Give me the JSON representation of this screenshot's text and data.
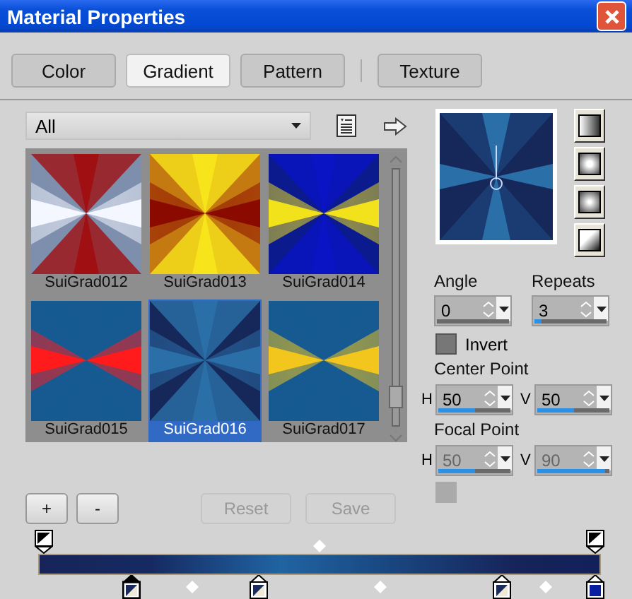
{
  "window": {
    "title": "Material Properties"
  },
  "tabs": [
    {
      "label": "Color",
      "selected": false
    },
    {
      "label": "Gradient",
      "selected": true
    },
    {
      "label": "Pattern",
      "selected": false
    },
    {
      "label": "Texture",
      "selected": false
    }
  ],
  "category": {
    "value": "All"
  },
  "gradients": [
    {
      "name": "SuiGrad012",
      "selected": false
    },
    {
      "name": "SuiGrad013",
      "selected": false
    },
    {
      "name": "SuiGrad014",
      "selected": false
    },
    {
      "name": "SuiGrad015",
      "selected": false
    },
    {
      "name": "SuiGrad016",
      "selected": true
    },
    {
      "name": "SuiGrad017",
      "selected": false
    }
  ],
  "angle": {
    "label": "Angle",
    "value": "0"
  },
  "repeats": {
    "label": "Repeats",
    "value": "3",
    "level": 0.1
  },
  "invert": {
    "label": "Invert",
    "checked": false
  },
  "center_point": {
    "label": "Center Point",
    "h": {
      "label": "H",
      "value": "50",
      "level": 0.5
    },
    "v": {
      "label": "V",
      "value": "50",
      "level": 0.5
    },
    "disabled": false
  },
  "focal_point": {
    "label": "Focal Point",
    "h": {
      "label": "H",
      "value": "50",
      "level": 0.5
    },
    "v": {
      "label": "V",
      "value": "90",
      "level": 0.95
    },
    "disabled": true
  },
  "focal_checkbox": {
    "checked": false,
    "disabled": true
  },
  "buttons": [
    {
      "label": "+",
      "disabled": false
    },
    {
      "label": "-",
      "disabled": false
    },
    {
      "label": "Reset",
      "disabled": true
    },
    {
      "label": "Save",
      "disabled": true
    }
  ],
  "opacity_stops": [
    {
      "level": 0,
      "selected": false
    },
    {
      "level": 1,
      "selected": false
    }
  ],
  "opacity_midpoints": [
    {
      "level": 0.5
    }
  ],
  "color_stops": [
    {
      "level": 0.16,
      "kind": "split",
      "selected": true
    },
    {
      "level": 0.39,
      "kind": "split",
      "selected": false
    },
    {
      "level": 0.83,
      "kind": "split",
      "selected": false
    },
    {
      "level": 1,
      "kind": "solid",
      "color": "#0a1ea0",
      "selected": false
    }
  ],
  "color_midpoints": [
    {
      "level": 0.27
    },
    {
      "level": 0.61
    },
    {
      "level": 0.91
    }
  ]
}
